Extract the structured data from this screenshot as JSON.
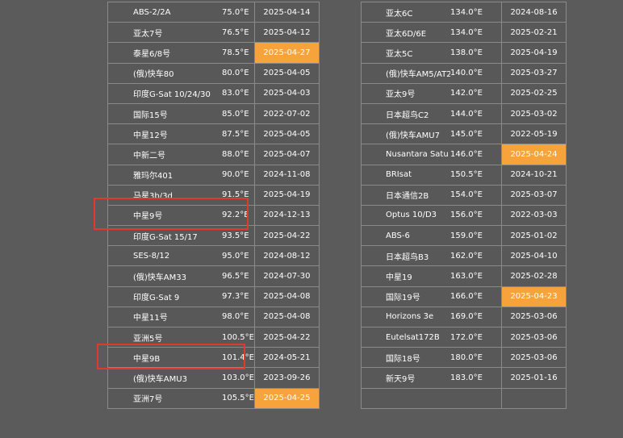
{
  "left_rows": [
    {
      "name": "ABS-2/2A",
      "lon": "75.0°E",
      "date": "2025-04-14",
      "hl": false
    },
    {
      "name": "亚太7号",
      "lon": "76.5°E",
      "date": "2025-04-12",
      "hl": false
    },
    {
      "name": "泰星6/8号",
      "lon": "78.5°E",
      "date": "2025-04-27",
      "hl": true
    },
    {
      "name": "(俄)快车80",
      "lon": "80.0°E",
      "date": "2025-04-05",
      "hl": false
    },
    {
      "name": "印度G-Sat 10/24/30",
      "lon": "83.0°E",
      "date": "2025-04-03",
      "hl": false
    },
    {
      "name": "国际15号",
      "lon": "85.0°E",
      "date": "2022-07-02",
      "hl": false
    },
    {
      "name": "中星12号",
      "lon": "87.5°E",
      "date": "2025-04-05",
      "hl": false
    },
    {
      "name": "中新二号",
      "lon": "88.0°E",
      "date": "2025-04-07",
      "hl": false
    },
    {
      "name": "雅玛尔401",
      "lon": "90.0°E",
      "date": "2024-11-08",
      "hl": false
    },
    {
      "name": "马星3b/3d",
      "lon": "91.5°E",
      "date": "2025-04-19",
      "hl": false
    },
    {
      "name": "中星9号",
      "lon": "92.2°E",
      "date": "2024-12-13",
      "hl": false
    },
    {
      "name": "印度G-Sat 15/17",
      "lon": "93.5°E",
      "date": "2025-04-22",
      "hl": false
    },
    {
      "name": "SES-8/12",
      "lon": "95.0°E",
      "date": "2024-08-12",
      "hl": false
    },
    {
      "name": "(俄)快车AM33",
      "lon": "96.5°E",
      "date": "2024-07-30",
      "hl": false
    },
    {
      "name": "印度G-Sat 9",
      "lon": "97.3°E",
      "date": "2025-04-08",
      "hl": false
    },
    {
      "name": "中星11号",
      "lon": "98.0°E",
      "date": "2025-04-08",
      "hl": false
    },
    {
      "name": "亚洲5号",
      "lon": "100.5°E",
      "date": "2025-04-22",
      "hl": false
    },
    {
      "name": "中星9B",
      "lon": "101.4°E",
      "date": "2024-05-21",
      "hl": false
    },
    {
      "name": "(俄)快车AMU3",
      "lon": "103.0°E",
      "date": "2023-09-26",
      "hl": false
    },
    {
      "name": "亚洲7号",
      "lon": "105.5°E",
      "date": "2025-04-25",
      "hl": true
    }
  ],
  "right_rows": [
    {
      "name": "亚太6C",
      "lon": "134.0°E",
      "date": "2024-08-16",
      "hl": false
    },
    {
      "name": "亚太6D/6E",
      "lon": "134.0°E",
      "date": "2025-02-21",
      "hl": false
    },
    {
      "name": "亚太5C",
      "lon": "138.0°E",
      "date": "2025-04-19",
      "hl": false
    },
    {
      "name": "(俄)快车AM5/AT2",
      "lon": "140.0°E",
      "date": "2025-03-27",
      "hl": false
    },
    {
      "name": "亚太9号",
      "lon": "142.0°E",
      "date": "2025-02-25",
      "hl": false
    },
    {
      "name": "日本超鸟C2",
      "lon": "144.0°E",
      "date": "2025-03-02",
      "hl": false
    },
    {
      "name": "(俄)快车AMU7",
      "lon": "145.0°E",
      "date": "2022-05-19",
      "hl": false
    },
    {
      "name": "Nusantara Satu",
      "lon": "146.0°E",
      "date": "2025-04-24",
      "hl": true
    },
    {
      "name": "BRIsat",
      "lon": "150.5°E",
      "date": "2024-10-21",
      "hl": false
    },
    {
      "name": "日本通信2B",
      "lon": "154.0°E",
      "date": "2025-03-07",
      "hl": false
    },
    {
      "name": "Optus 10/D3",
      "lon": "156.0°E",
      "date": "2022-03-03",
      "hl": false
    },
    {
      "name": "ABS-6",
      "lon": "159.0°E",
      "date": "2025-01-02",
      "hl": false
    },
    {
      "name": "日本超鸟B3",
      "lon": "162.0°E",
      "date": "2025-04-10",
      "hl": false
    },
    {
      "name": "中星19",
      "lon": "163.0°E",
      "date": "2025-02-28",
      "hl": false
    },
    {
      "name": "国际19号",
      "lon": "166.0°E",
      "date": "2025-04-23",
      "hl": true
    },
    {
      "name": "Horizons 3e",
      "lon": "169.0°E",
      "date": "2025-03-06",
      "hl": false
    },
    {
      "name": "Eutelsat172B",
      "lon": "172.0°E",
      "date": "2025-03-06",
      "hl": false
    },
    {
      "name": "国际18号",
      "lon": "180.0°E",
      "date": "2025-03-06",
      "hl": false
    },
    {
      "name": "新天9号",
      "lon": "183.0°E",
      "date": "2025-01-16",
      "hl": false
    },
    {
      "name": "",
      "lon": "",
      "date": "",
      "hl": false
    }
  ],
  "colors": {
    "highlight": "#f5a33a",
    "annotation": "#e03a2f",
    "cell_bg": "#585858",
    "page_bg": "#5b5b5b"
  }
}
